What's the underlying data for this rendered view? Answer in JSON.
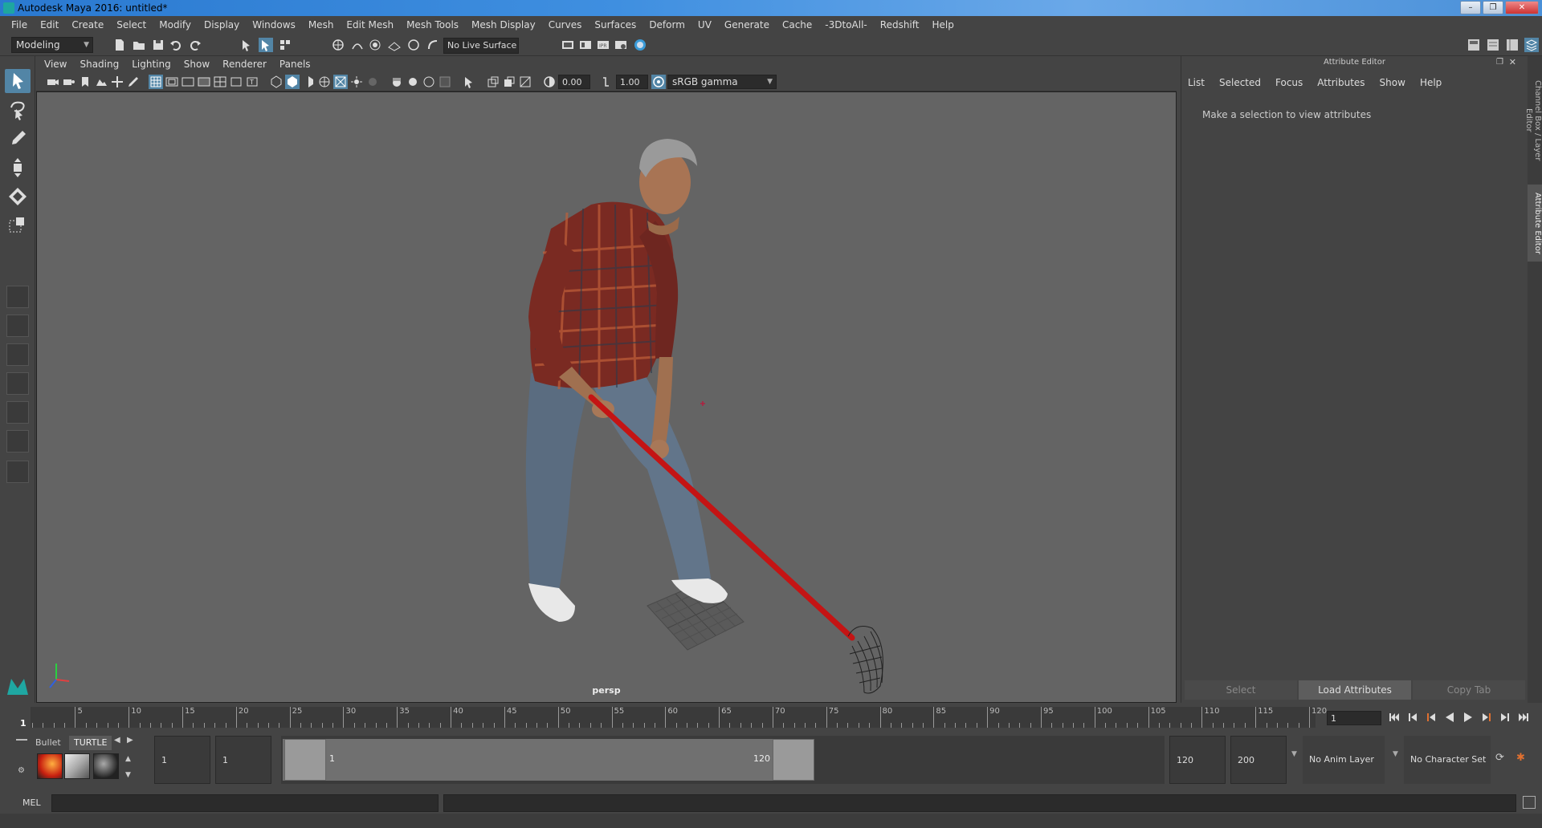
{
  "window": {
    "title": "Autodesk Maya 2016: untitled*"
  },
  "menu": {
    "items": [
      "File",
      "Edit",
      "Create",
      "Select",
      "Modify",
      "Display",
      "Windows",
      "Mesh",
      "Edit Mesh",
      "Mesh Tools",
      "Mesh Display",
      "Curves",
      "Surfaces",
      "Deform",
      "UV",
      "Generate",
      "Cache",
      "-3DtoAll-",
      "Redshift",
      "Help"
    ]
  },
  "status_line": {
    "mode": "Modeling",
    "live_surface": "No Live Surface"
  },
  "panel": {
    "menu": [
      "View",
      "Shading",
      "Lighting",
      "Show",
      "Renderer",
      "Panels"
    ],
    "exposure": "0.00",
    "gamma": "1.00",
    "color_space": "sRGB gamma",
    "camera_label": "persp"
  },
  "attribute_editor": {
    "title": "Attribute Editor",
    "menu": [
      "List",
      "Selected",
      "Focus",
      "Attributes",
      "Show",
      "Help"
    ],
    "message": "Make a selection to view attributes",
    "buttons": {
      "select": "Select",
      "load": "Load Attributes",
      "copy": "Copy Tab"
    }
  },
  "side_tabs": {
    "channel_box": "Channel Box / Layer Editor",
    "attribute_editor": "Attribute Editor"
  },
  "time_slider": {
    "current_frame": "1",
    "current_frame_field": "1",
    "tick_labels": [
      "5",
      "10",
      "15",
      "20",
      "25",
      "30",
      "35",
      "40",
      "45",
      "50",
      "55",
      "60",
      "65",
      "70",
      "75",
      "80",
      "85",
      "90",
      "95",
      "100",
      "105",
      "110",
      "115",
      "120"
    ],
    "tick_values": [
      5,
      10,
      15,
      20,
      25,
      30,
      35,
      40,
      45,
      50,
      55,
      60,
      65,
      70,
      75,
      80,
      85,
      90,
      95,
      100,
      105,
      110,
      115,
      120
    ],
    "start": 1,
    "end": 120
  },
  "shelf": {
    "tabs": [
      "Bullet",
      "TURTLE"
    ]
  },
  "range_slider": {
    "start_time": "1",
    "playback_start": "1",
    "range_start_label": "1",
    "range_end_label": "120",
    "playback_end": "120",
    "end_time": "200",
    "anim_layer": "No Anim Layer",
    "character_set": "No Character Set"
  },
  "command_line": {
    "label": "MEL"
  },
  "colors": {
    "accent": "#5285a6",
    "viewport_bg": "#646464",
    "rake_handle": "#c41414"
  }
}
